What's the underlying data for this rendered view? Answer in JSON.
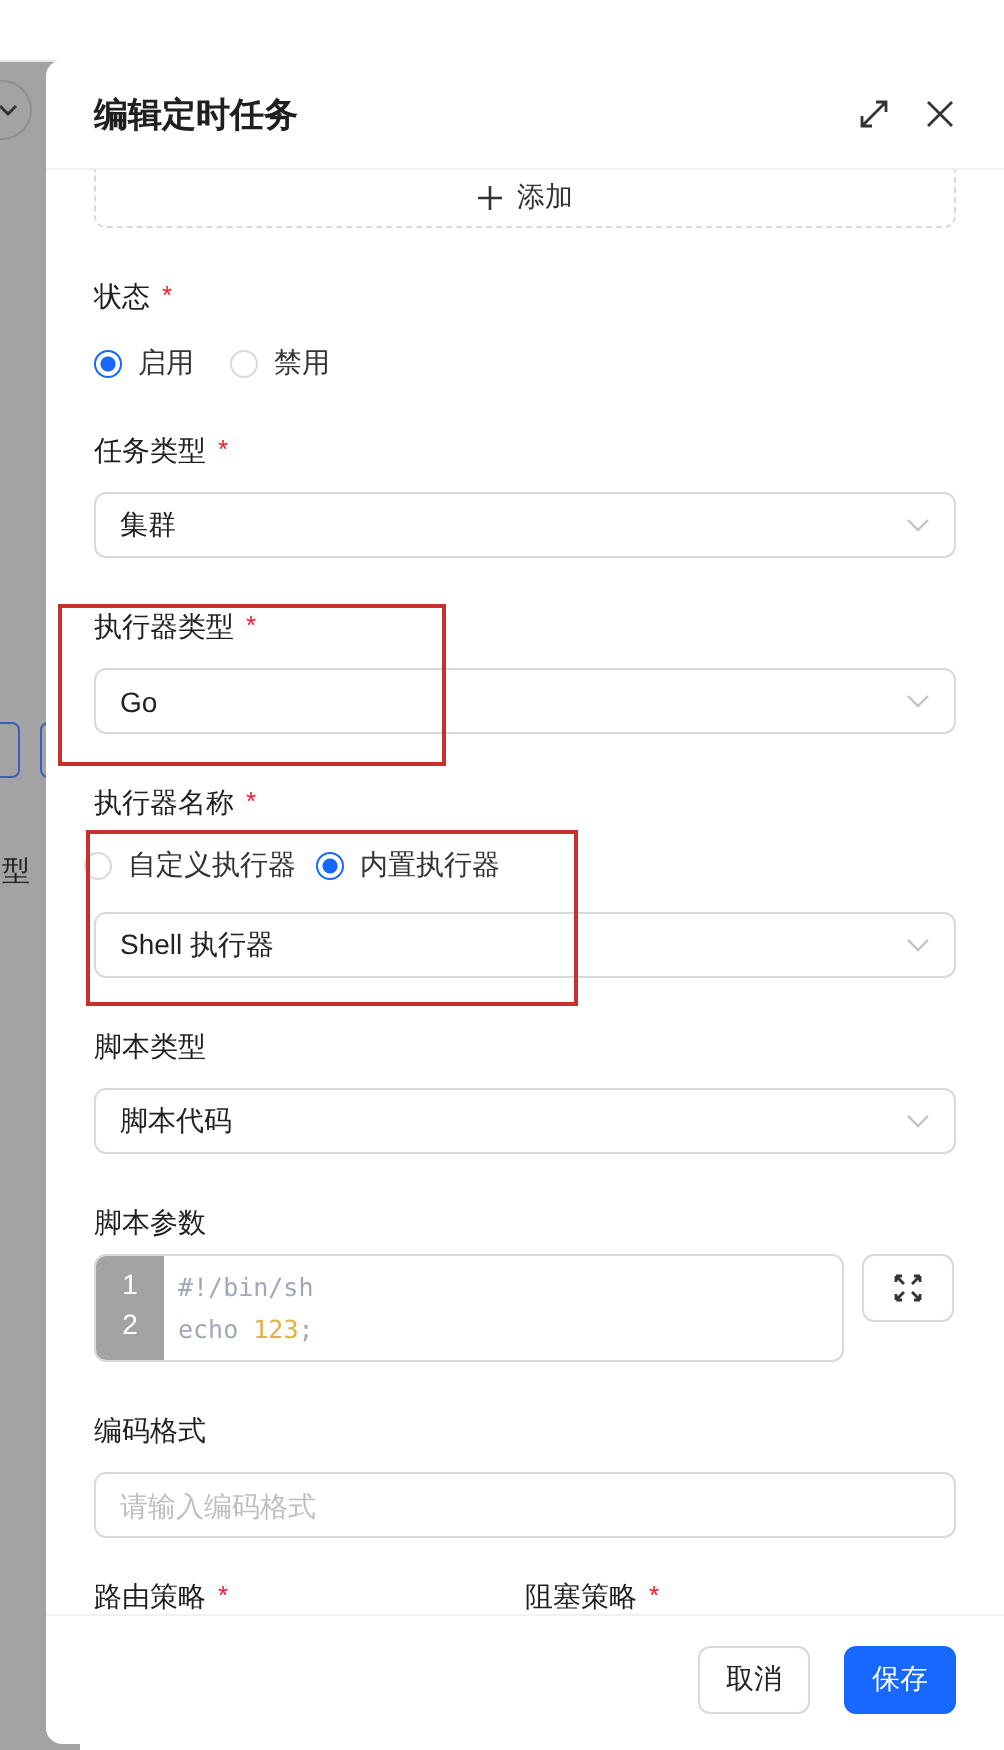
{
  "backdrop": {
    "text": "型"
  },
  "drawer": {
    "title": "编辑定时任务",
    "add_button": {
      "label": "添加"
    },
    "fields": [
      {
        "kind": "radio",
        "label": "状态",
        "mark": "*",
        "options": [
          {
            "label": "启用",
            "selected": true
          },
          {
            "label": "禁用",
            "selected": false
          }
        ]
      },
      {
        "kind": "select",
        "label": "任务类型",
        "mark": "*",
        "value": "集群"
      },
      {
        "kind": "select",
        "label": "执行器类型",
        "mark": "*",
        "value": "Go",
        "highlighted": true
      },
      {
        "kind": "radio-select",
        "label": "执行器名称",
        "mark": "*",
        "options": [
          {
            "label": "自定义执行器",
            "selected": false
          },
          {
            "label": "内置执行器",
            "selected": true
          }
        ],
        "value": "Shell 执行器",
        "highlighted": true
      },
      {
        "kind": "select",
        "label": "脚本类型",
        "value": "脚本代码"
      },
      {
        "kind": "code",
        "label": "脚本参数",
        "line_numbers": [
          "1",
          "2"
        ],
        "lines": [
          [
            {
              "text": "#!/bin/sh",
              "kind": "comment"
            }
          ],
          [
            {
              "text": "echo ",
              "kind": "plain"
            },
            {
              "text": "123",
              "kind": "number"
            },
            {
              "text": ";",
              "kind": "plain"
            }
          ]
        ]
      },
      {
        "kind": "input",
        "label": "编码格式",
        "placeholder": "请输入编码格式"
      },
      {
        "kind": "pair",
        "labels": [
          {
            "label": "路由策略",
            "mark": "*"
          },
          {
            "label": "阻塞策略",
            "mark": "*"
          }
        ]
      }
    ],
    "buttons": [
      {
        "label": "取消",
        "kind": "secondary"
      },
      {
        "label": "保存",
        "kind": "primary"
      }
    ]
  }
}
